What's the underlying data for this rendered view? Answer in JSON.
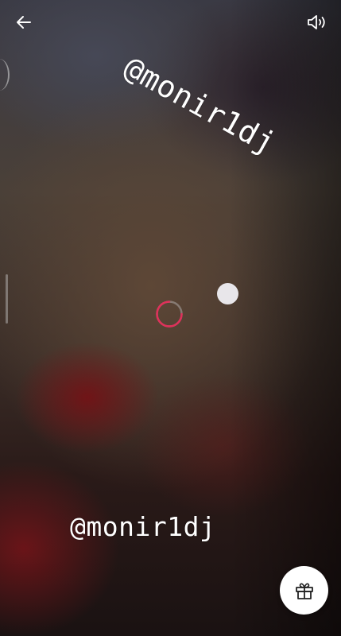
{
  "header": {
    "back_icon": "arrow-left-icon",
    "volume_icon": "speaker-volume-icon"
  },
  "watermarks": {
    "top": "@monir1dj",
    "bottom": "@monir1dj"
  },
  "player": {
    "state": "loading",
    "accent_color": "#e0305a"
  },
  "actions": {
    "gift_icon": "gift-icon"
  }
}
